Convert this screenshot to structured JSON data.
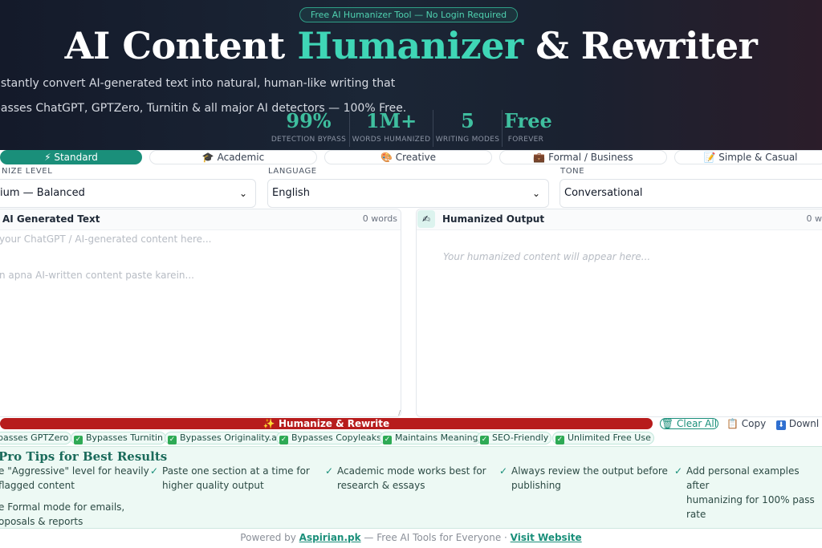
{
  "hero": {
    "pill": "Free AI Humanizer Tool — No Login Required",
    "title_part1": "AI Content ",
    "title_accent": "Humanizer",
    "title_part2": " & Rewriter",
    "subtitle_line1": "nstantly convert AI-generated text into natural, human-like writing that",
    "subtitle_line2": "passes ChatGPT, GPTZero, Turnitin & all major AI detectors — 100% Free.",
    "stats": [
      {
        "value": "99%",
        "label": "DETECTION BYPASS"
      },
      {
        "value": "1M+",
        "label": "WORDS HUMANIZED"
      },
      {
        "value": "5",
        "label": "WRITING MODES"
      },
      {
        "value": "Free",
        "label": "FOREVER"
      }
    ]
  },
  "modes": [
    {
      "icon": "⚡",
      "label": "Standard"
    },
    {
      "icon": "🎓",
      "label": "Academic"
    },
    {
      "icon": "🎨",
      "label": "Creative"
    },
    {
      "icon": "💼",
      "label": "Formal / Business"
    },
    {
      "icon": "📝",
      "label": "Simple & Casual"
    }
  ],
  "settings": {
    "level_label": "NIZE LEVEL",
    "level_value": "ium — Balanced",
    "language_label": "LANGUAGE",
    "language_value": "English",
    "tone_label": "TONE",
    "tone_value": "Conversational"
  },
  "input_panel": {
    "title": "AI Generated Text",
    "count": "0 words",
    "placeholder_1": " your ChatGPT / AI-generated content here...",
    "placeholder_2": "n apna AI-written content paste karein..."
  },
  "output_panel": {
    "title": "Humanized Output",
    "count": "0 w",
    "placeholder": "Your humanized content will appear here..."
  },
  "actions": {
    "humanize": "✨ Humanize & Rewrite",
    "clear": "Clear All",
    "copy": "Copy",
    "download": "Downl"
  },
  "features": [
    "passes GPTZero",
    "Bypasses Turnitin",
    "Bypasses Originality.ai",
    "Bypasses Copyleaks",
    "Maintains Meaning",
    "SEO-Friendly",
    "Unlimited Free Use"
  ],
  "tips": {
    "title": "Pro Tips for Best Results",
    "items": [
      {
        "line1": "e \"Aggressive\" level for heavily",
        "line2": " flagged content"
      },
      {
        "line1": "Paste one section at a time for",
        "line2": "higher quality output"
      },
      {
        "line1": "Academic mode works best for",
        "line2": "research & essays"
      },
      {
        "line1": "Always review the output before",
        "line2": "publishing"
      },
      {
        "line1": "Add personal examples after",
        "line2": "humanizing for 100% pass rate"
      },
      {
        "line1": "e Formal mode for emails,",
        "line2": "oposals & reports"
      }
    ]
  },
  "footer": {
    "prefix": "Powered by ",
    "brand": "Aspirian.pk",
    "middle": " — Free AI Tools for Everyone · ",
    "link": "Visit Website"
  }
}
